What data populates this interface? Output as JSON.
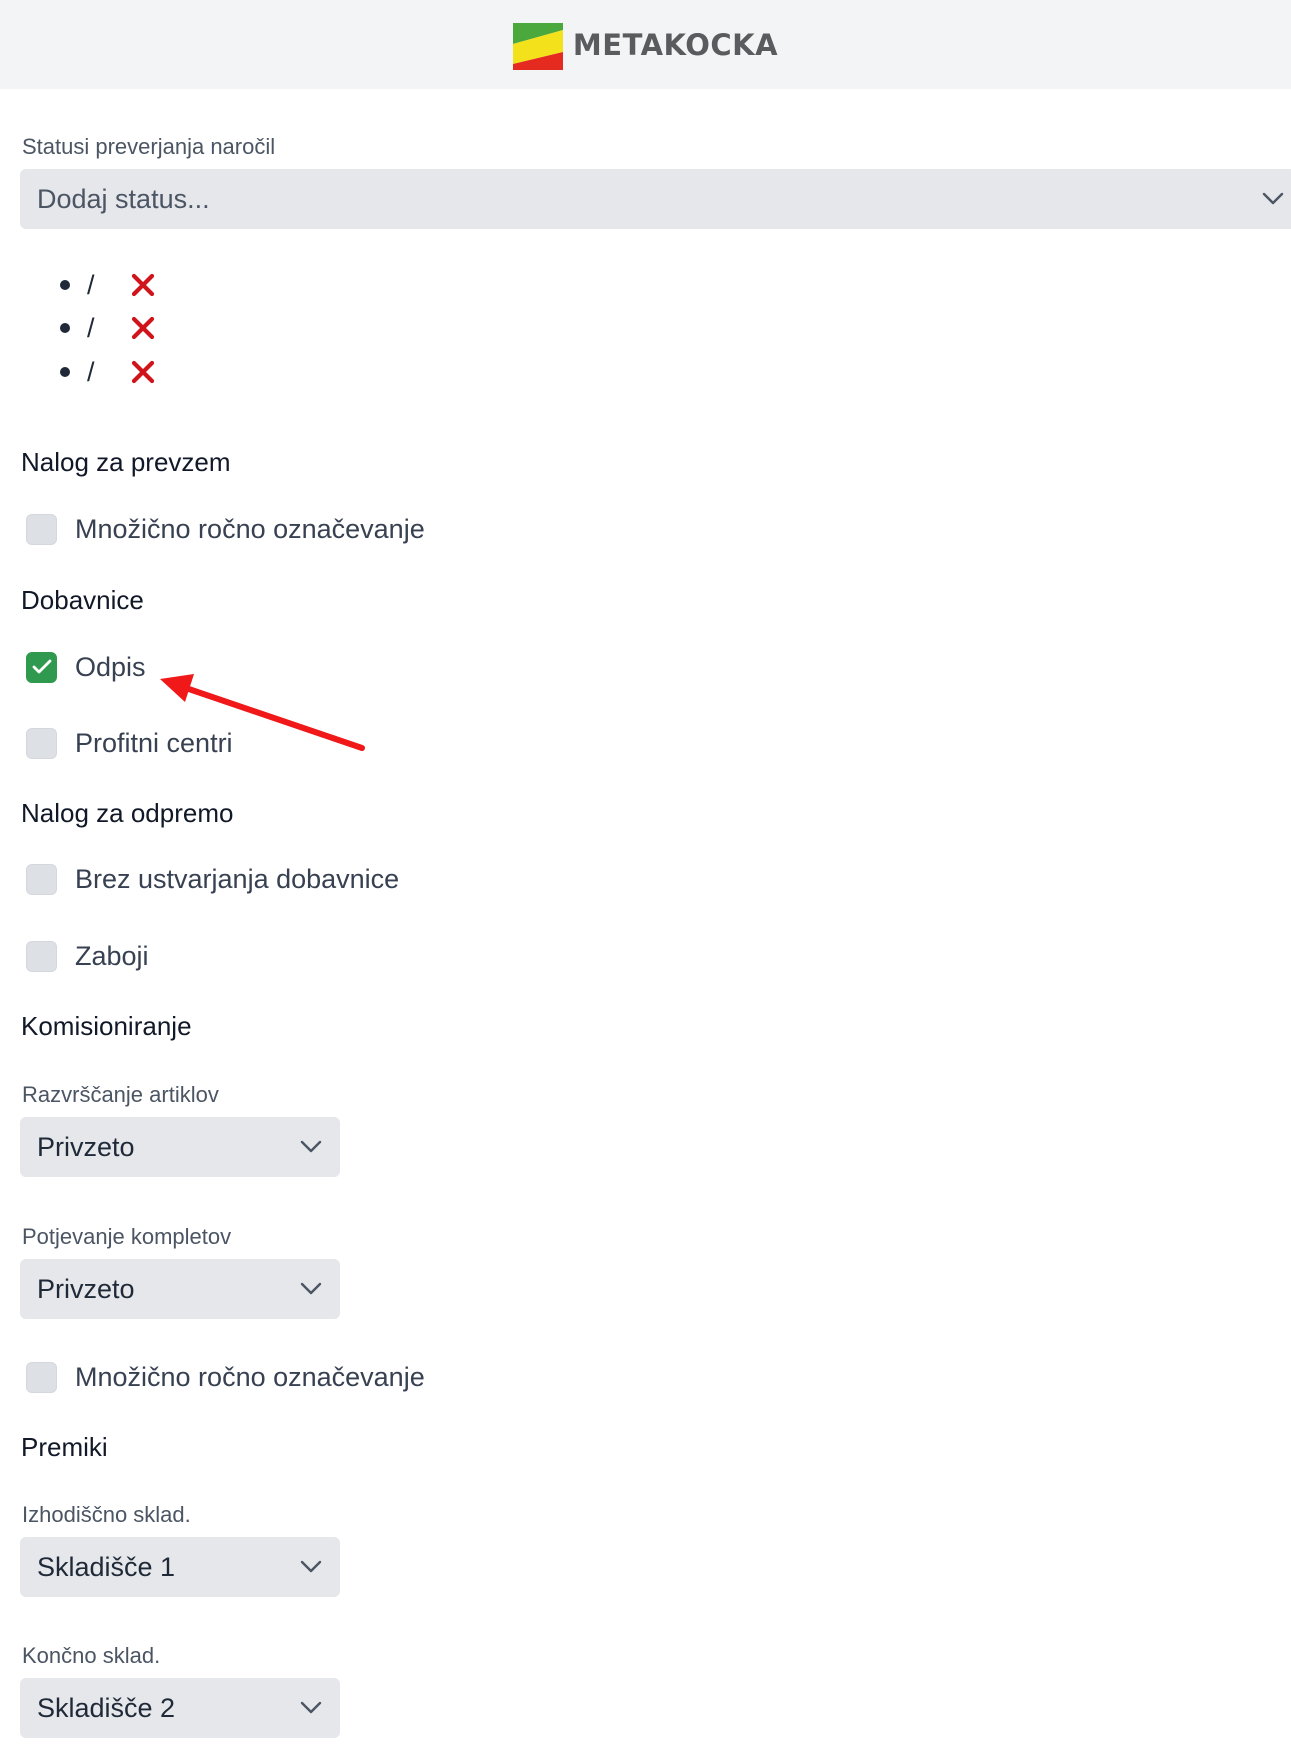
{
  "header": {
    "brand": "METAKOCKA",
    "logo_icon": "metakocka-logo-icon"
  },
  "colors": {
    "header_bg": "#f3f4f6",
    "select_bg": "#e5e7eb",
    "checkbox_checked": "#2f9a4f",
    "remove_icon": "#d0141b",
    "annotation_arrow": "#f01818"
  },
  "order_status": {
    "label": "Statusi preverjanja naročil",
    "select_placeholder": "Dodaj status...",
    "items": [
      {
        "value": "/",
        "remove_icon": "x-icon"
      },
      {
        "value": "/",
        "remove_icon": "x-icon"
      },
      {
        "value": "/",
        "remove_icon": "x-icon"
      }
    ]
  },
  "pickup_order": {
    "heading": "Nalog za prevzem",
    "bulk_manual": {
      "label": "Množično ročno označevanje",
      "checked": false
    }
  },
  "delivery_notes": {
    "heading": "Dobavnice",
    "writeoff": {
      "label": "Odpis",
      "checked": true
    },
    "profit_centers": {
      "label": "Profitni centri",
      "checked": false
    }
  },
  "shipping_order": {
    "heading": "Nalog za odpremo",
    "no_delivery_note": {
      "label": "Brez ustvarjanja dobavnice",
      "checked": false
    },
    "crates": {
      "label": "Zaboji",
      "checked": false
    }
  },
  "picking": {
    "heading": "Komisioniranje",
    "sort_items": {
      "label": "Razvrščanje artiklov",
      "value": "Privzeto"
    },
    "confirm_sets": {
      "label": "Potjevanje kompletov",
      "value": "Privzeto"
    },
    "bulk_manual": {
      "label": "Množično ročno označevanje",
      "checked": false
    }
  },
  "moves": {
    "heading": "Premiki",
    "source_wh": {
      "label": "Izhodiščno sklad.",
      "value": "Skladišče 1"
    },
    "target_wh": {
      "label": "Končno sklad.",
      "value": "Skladišče 2"
    }
  }
}
